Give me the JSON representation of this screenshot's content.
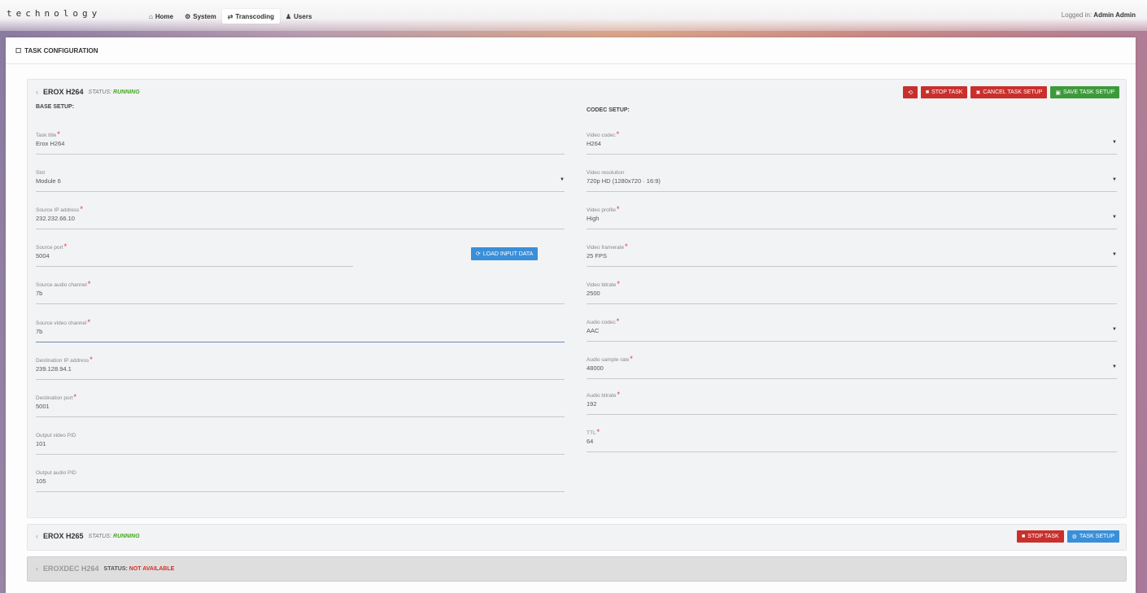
{
  "brand": "technology",
  "nav": {
    "items": [
      {
        "icon": "home-icon",
        "glyph": "⌂",
        "label": "Home"
      },
      {
        "icon": "wrench-icon",
        "glyph": "⚙",
        "label": "System"
      },
      {
        "icon": "shuffle-icon",
        "glyph": "⇄",
        "label": "Transcoding"
      },
      {
        "icon": "user-icon",
        "glyph": "♟",
        "label": "Users"
      }
    ],
    "logged_prefix": "Logged in:",
    "logged_user": "Admin Admin"
  },
  "panel": {
    "title": "TASK CONFIGURATION"
  },
  "task1": {
    "chevron": "‹",
    "name": "EROX H264",
    "status_prefix": "STATUS:",
    "status": "RUNNING",
    "buttons": {
      "refresh": "⟲",
      "stop": "STOP TASK",
      "cancel": "CANCEL TASK SETUP",
      "save": "SAVE TASK SETUP"
    },
    "base_setup": {
      "title": "BASE SETUP:",
      "fields": [
        {
          "label": "Task title",
          "required": "*",
          "value": "Erox H264"
        },
        {
          "label": "Slot",
          "required": "",
          "value": "Module 6"
        },
        {
          "label": "Source IP address",
          "required": "*",
          "value": "232.232.66.10"
        },
        {
          "label": "Source port",
          "required": "*",
          "value": "5004"
        },
        {
          "label": "Source audio channel",
          "required": "*",
          "value": "7b"
        },
        {
          "label": "Source video channel",
          "required": "*",
          "value": "7b"
        },
        {
          "label": "Destination IP address",
          "required": "*",
          "value": "239.128.94.1"
        },
        {
          "label": "Destination port",
          "required": "*",
          "value": "5001"
        },
        {
          "label": "Output video PID",
          "required": "",
          "value": "101"
        },
        {
          "label": "Output audio PID",
          "required": "",
          "value": "105"
        }
      ],
      "load_button": "LOAD INPUT DATA"
    },
    "codec_setup": {
      "title": "CODEC SETUP:",
      "fields": [
        {
          "label": "Video codec",
          "required": "*",
          "value": "H264"
        },
        {
          "label": "Video resolution",
          "required": "",
          "value": "720p HD (1280x720 · 16:9)"
        },
        {
          "label": "Video profile",
          "required": "*",
          "value": "High"
        },
        {
          "label": "Video framerate",
          "required": "*",
          "value": "25 FPS"
        },
        {
          "label": "Video bitrate",
          "required": "*",
          "value": "2500"
        },
        {
          "label": "Audio codec",
          "required": "*",
          "value": "AAC"
        },
        {
          "label": "Audio sample rate",
          "required": "*",
          "value": "48000"
        },
        {
          "label": "Audio bitrate",
          "required": "*",
          "value": "192"
        },
        {
          "label": "TTL",
          "required": "*",
          "value": "64"
        }
      ]
    }
  },
  "task2": {
    "chevron": "‹",
    "name": "EROX H265",
    "status_prefix": "STATUS:",
    "status": "RUNNING",
    "buttons": {
      "stop": "STOP TASK",
      "setup": "TASK SETUP"
    }
  },
  "task3": {
    "chevron": "‹",
    "name": "EROXDEC H264",
    "status_prefix": "STATUS:",
    "status": "NOT AVAILABLE"
  },
  "colors": {
    "red": "#c9302c",
    "green": "#3d9a3a",
    "blue": "#3a8fd9",
    "status_ok": "#44a820",
    "status_na": "#d0302a"
  }
}
